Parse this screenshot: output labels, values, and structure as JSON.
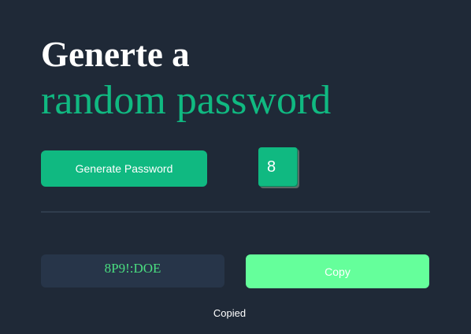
{
  "header": {
    "title_line1": "Generte a",
    "title_line2": "random password"
  },
  "controls": {
    "generate_label": "Generate Password",
    "length_value": "8"
  },
  "output": {
    "password": "8P9!:DOE",
    "copy_label": "Copy",
    "status": "Copied"
  },
  "colors": {
    "background": "#1f2937",
    "accent": "#10b981",
    "copy_button": "#65ff9b",
    "password_text": "#4ade80",
    "password_box": "#273549"
  }
}
